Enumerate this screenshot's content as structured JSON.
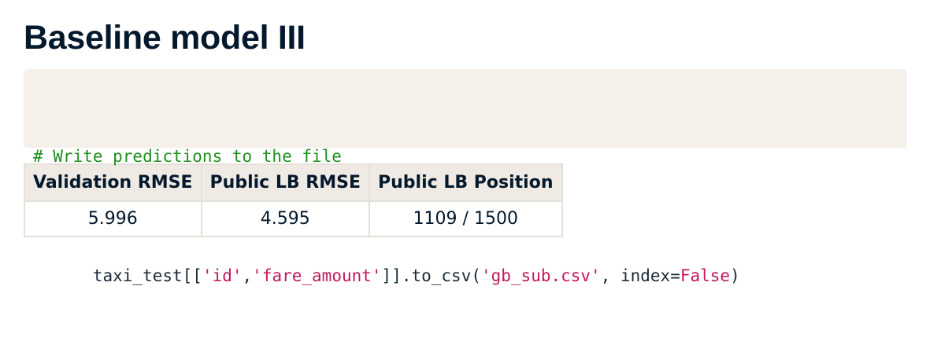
{
  "slide": {
    "title": "Baseline model III"
  },
  "code": {
    "comment": "# Write predictions to the file",
    "line2": [
      {
        "type": "plain",
        "text": "taxi_test[["
      },
      {
        "type": "string",
        "text": "'id'"
      },
      {
        "type": "plain",
        "text": ","
      },
      {
        "type": "string",
        "text": "'fare_amount'"
      },
      {
        "type": "plain",
        "text": "]].to_csv("
      },
      {
        "type": "string",
        "text": "'gb_sub.csv'"
      },
      {
        "type": "plain",
        "text": ", index="
      },
      {
        "type": "keyword",
        "text": "False"
      },
      {
        "type": "plain",
        "text": ")"
      }
    ]
  },
  "table": {
    "headers": [
      "Validation RMSE",
      "Public LB RMSE",
      "Public LB Position"
    ],
    "rows": [
      [
        "5.996",
        "4.595",
        "1109 / 1500"
      ]
    ]
  },
  "colors": {
    "title": "#05192d",
    "code_background": "#f5f1ea",
    "comment": "#1e8f1e",
    "string": "#c2185b",
    "table_header_background": "#efebe4",
    "table_border": "#e5e1da"
  }
}
